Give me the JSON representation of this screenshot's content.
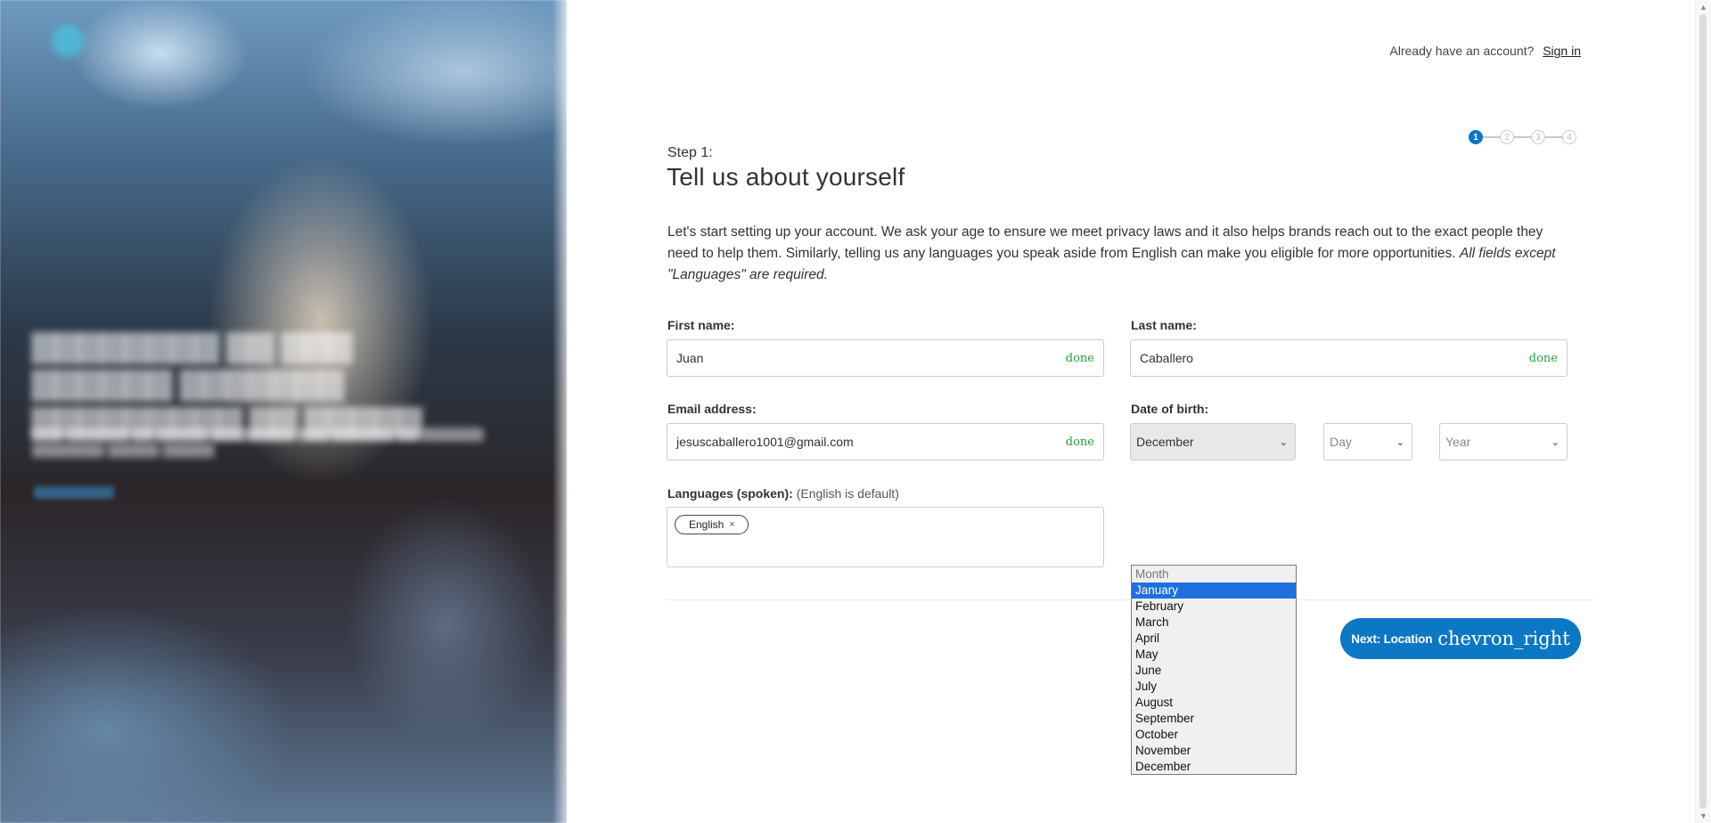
{
  "header": {
    "signin_prompt": "Already have an account?",
    "signin_link": "Sign in"
  },
  "stepper": {
    "steps": [
      "1",
      "2",
      "3",
      "4"
    ],
    "current": 1
  },
  "step_label": "Step 1:",
  "title": "Tell us about yourself",
  "intro": {
    "text": "Let's start setting up your account. We ask your age to ensure we meet privacy laws and it also helps brands reach out to the exact people they need to help them. Similarly, telling us any languages you speak aside from English can make you eligible for more opportunities.",
    "emphasis": "All fields except \"Languages\" are required."
  },
  "fields": {
    "first_name": {
      "label": "First name:",
      "value": "Juan",
      "status": "done"
    },
    "last_name": {
      "label": "Last name:",
      "value": "Caballero",
      "status": "done"
    },
    "email": {
      "label": "Email address:",
      "value": "jesuscaballero1001@gmail.com",
      "status": "done"
    },
    "dob": {
      "label": "Date of birth:",
      "month": "December",
      "day": "Day",
      "year": "Year"
    },
    "languages": {
      "label": "Languages (spoken):",
      "hint": "(English is default)",
      "chips": [
        {
          "label": "English",
          "remove": "×"
        }
      ]
    }
  },
  "month_options": [
    "Month",
    "January",
    "February",
    "March",
    "April",
    "May",
    "June",
    "July",
    "August",
    "September",
    "October",
    "November",
    "December"
  ],
  "highlighted_month": "January",
  "next_button": {
    "label": "Next: Location",
    "icon": "chevron_right"
  },
  "colors": {
    "primary": "#0b77c5",
    "done": "#2a9b45",
    "highlight": "#1e6fe0"
  }
}
